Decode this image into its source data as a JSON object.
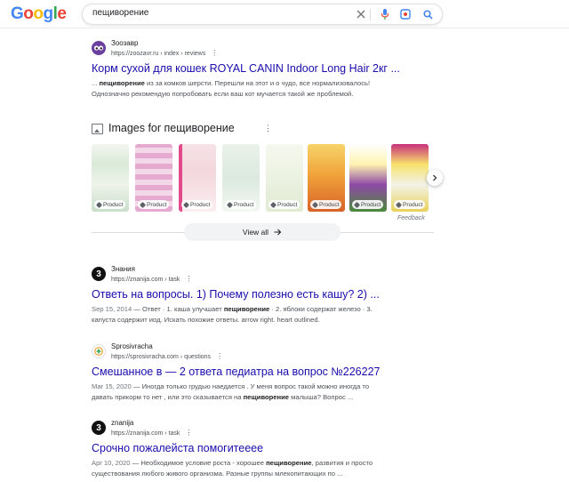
{
  "header": {
    "logo_letters": [
      {
        "ch": "G",
        "color": "#4285f4"
      },
      {
        "ch": "o",
        "color": "#ea4335"
      },
      {
        "ch": "o",
        "color": "#fbbc05"
      },
      {
        "ch": "g",
        "color": "#4285f4"
      },
      {
        "ch": "l",
        "color": "#34a853"
      },
      {
        "ch": "e",
        "color": "#ea4335"
      }
    ],
    "query": "пещиворение",
    "icons": [
      "close-icon",
      "microphone-icon",
      "lens-icon",
      "search-icon"
    ]
  },
  "results": [
    {
      "site": "Зоозавр",
      "url": "https://zoozavr.ru › index › reviews",
      "title": "Корм сухой для кошек ROYAL CANIN Indoor Long Hair 2кг ...",
      "snippet": {
        "date": "",
        "line1_pre": "... ",
        "line1_bold": "пещиворение",
        "line1_post": " из за комков шерсти. Перешли на этот и о чудо, все нормализовалось!",
        "line2": "Однозначно рекомендую попробовать если ваш кот мучается такой же проблемой."
      }
    },
    {
      "site": "Знания",
      "url": "https://znanija.com › task",
      "title": "Ответь на вопросы. 1) Почему полезно есть кашу? 2) ...",
      "snippet": {
        "date": "Sep 15, 2014",
        "line1_pre": " — Ответ · 1. каша улучшает ",
        "line1_bold": "пещиворение",
        "line1_post": " · 2. яблоки содержат железо · 3.",
        "line2": "капуста содержит иод. Искать похожие ответы. arrow right. heart outlined."
      }
    },
    {
      "site": "Sprosivracha",
      "url": "https://sprosivracha.com › questions",
      "title": "Смешанное в — 2 ответа педиатра на вопрос №226227",
      "snippet": {
        "date": "Mar 15, 2020",
        "line1_pre": " — Иногда только грудью наедается . У меня вопрос такой можно иногда то",
        "line1_bold": "",
        "line1_post": "",
        "line2_pre": "давать прикорм то нет , или это сказывается на ",
        "line2_bold": "пещиворение",
        "line2_post": " малыша? Вопрос ..."
      }
    },
    {
      "site": "znanija",
      "url": "https://znanija.com › task",
      "title": "Срочно пожалейста помогитееее",
      "snippet": {
        "date": "Apr 10, 2020",
        "line1_pre": " — Необходимое условие роста - хорошее ",
        "line1_bold": "пещиворение",
        "line1_post": ", развития и просто",
        "line2": "существования любого живого организма. Разные группы млекопитающих по ..."
      }
    }
  ],
  "images": {
    "heading": "Images for пещиворение",
    "tag_label": "Product",
    "feedback": "Feedback",
    "view_all": "View all",
    "thumb_colors": [
      "#d9ead8",
      "#e8b7d6",
      "#f3d7dd",
      "#dbeadf",
      "#ecf2e2",
      "#f0a43a",
      "#8f4aa6",
      "#c8307a"
    ]
  }
}
